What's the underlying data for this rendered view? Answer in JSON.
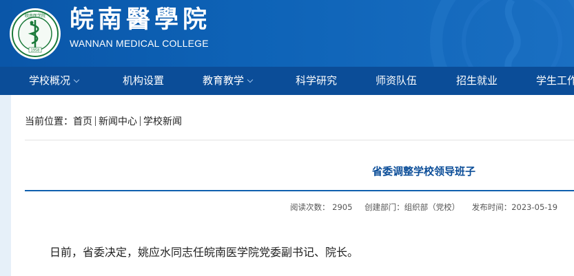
{
  "header": {
    "school_name_cn": "皖南醫學院",
    "school_name_en": "WANNAN MEDICAL COLLEGE",
    "emblem_top_text": "皖南医学院",
    "emblem_year": "1958"
  },
  "nav": {
    "items": [
      {
        "label": "学校概况",
        "dropdown": true
      },
      {
        "label": "机构设置",
        "dropdown": false
      },
      {
        "label": "教育教学",
        "dropdown": true
      },
      {
        "label": "科学研究",
        "dropdown": false
      },
      {
        "label": "师资队伍",
        "dropdown": false
      },
      {
        "label": "招生就业",
        "dropdown": false
      },
      {
        "label": "学生工作",
        "dropdown": false
      }
    ]
  },
  "breadcrumb": {
    "prefix": "当前位置：",
    "items": [
      "首页",
      "新闻中心",
      "学校新闻"
    ]
  },
  "article": {
    "title": "省委调整学校领导班子",
    "views": "阅读次数： 2905",
    "department": "创建部门：组织部（党校）",
    "published": "发布时间：2023-05-19",
    "body": "日前，省委决定，姚应水同志任皖南医学院党委副书记、院长。"
  },
  "colors": {
    "header_blue": "#0e63b7",
    "nav_blue": "#0b4d98",
    "title_blue": "#0b4d98",
    "side_strip": "#e6f0f9"
  }
}
